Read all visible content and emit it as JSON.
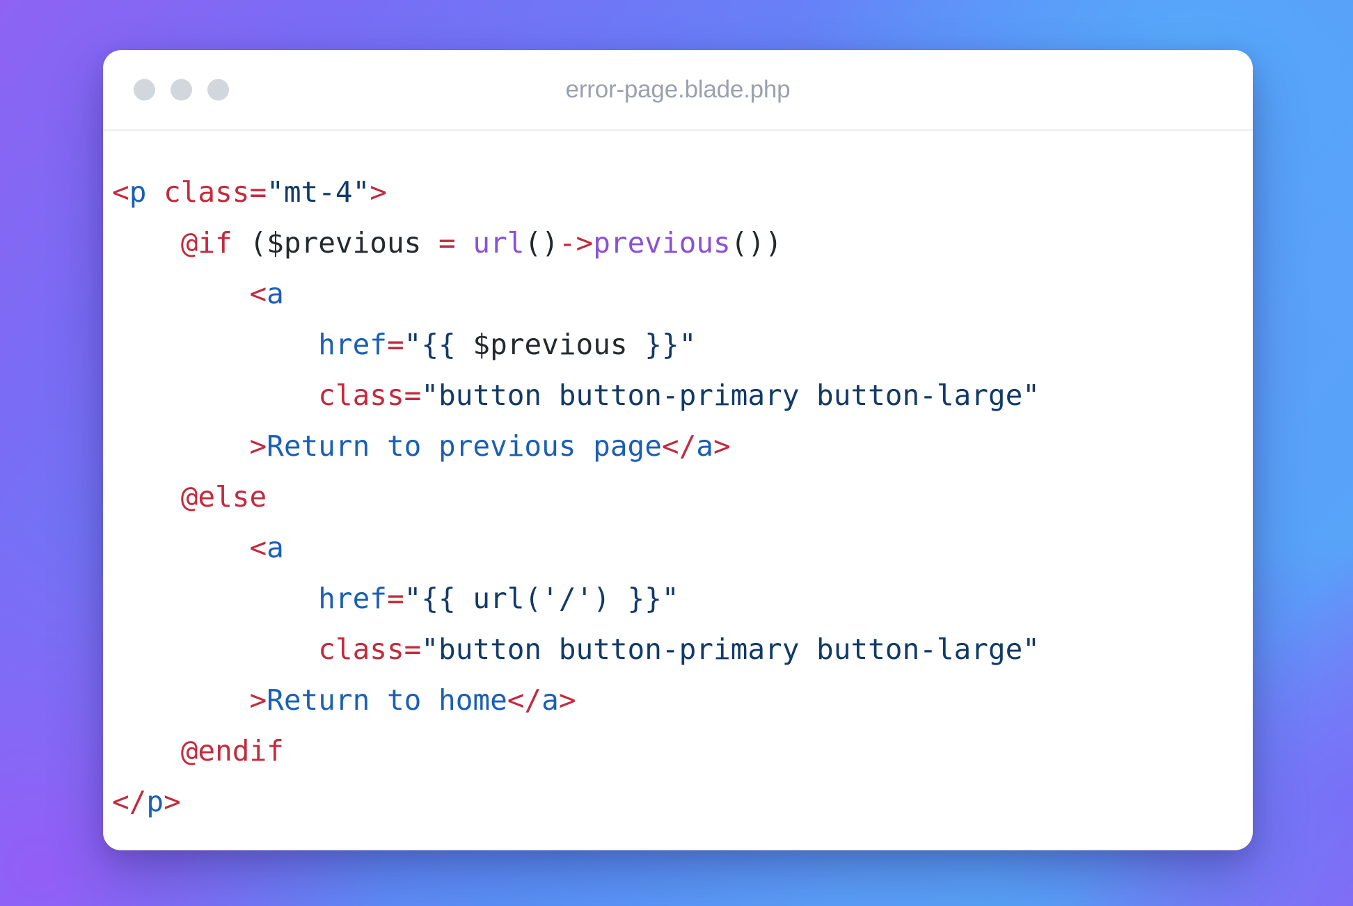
{
  "window": {
    "title": "error-page.blade.php",
    "traffic_lights": [
      {
        "name": "close",
        "color": "#d2d6dd"
      },
      {
        "name": "minimize",
        "color": "#d2d6dd"
      },
      {
        "name": "maximize",
        "color": "#d2d6dd"
      }
    ]
  },
  "theme": {
    "background_gradient_from": "#8e63f3",
    "background_gradient_to": "#57a4f9",
    "card_background": "#ffffff",
    "title_color": "#9aa1ae",
    "syntax_punctuation": "#c32b3d",
    "syntax_tag": "#1b5fb5",
    "syntax_string": "#123a68",
    "syntax_plain": "#24292e",
    "syntax_function": "#8a51d6",
    "syntax_keyword": "#c32b3d"
  },
  "code": {
    "language": "blade-php",
    "plain_text": "<p class=\"mt-4\">\n    @if ($previous = url()->previous())\n        <a\n            href=\"{{ $previous }}\"\n            class=\"button button-primary button-large\"\n        >Return to previous page</a>\n    @else\n        <a\n            href=\"{{ url('/') }}\"\n            class=\"button button-primary button-large\"\n        >Return to home</a>\n    @endif\n</p>",
    "lines": [
      {
        "n": 1,
        "indent": 0,
        "tokens": [
          {
            "t": "<",
            "c": "punct"
          },
          {
            "t": "p",
            "c": "tag"
          },
          {
            "t": " ",
            "c": "plain"
          },
          {
            "t": "class=",
            "c": "attr-red"
          },
          {
            "t": "\"mt-4\"",
            "c": "str"
          },
          {
            "t": ">",
            "c": "punct"
          }
        ]
      },
      {
        "n": 2,
        "indent": 1,
        "tokens": [
          {
            "t": "@if",
            "c": "kw"
          },
          {
            "t": " ($previous ",
            "c": "plain"
          },
          {
            "t": "=",
            "c": "punct"
          },
          {
            "t": " ",
            "c": "plain"
          },
          {
            "t": "url",
            "c": "fn"
          },
          {
            "t": "()",
            "c": "plain"
          },
          {
            "t": "->",
            "c": "punct"
          },
          {
            "t": "previous",
            "c": "fn"
          },
          {
            "t": "())",
            "c": "plain"
          }
        ]
      },
      {
        "n": 3,
        "indent": 2,
        "tokens": [
          {
            "t": "<",
            "c": "punct"
          },
          {
            "t": "a",
            "c": "tag"
          }
        ]
      },
      {
        "n": 4,
        "indent": 3,
        "tokens": [
          {
            "t": "href",
            "c": "attr-blue"
          },
          {
            "t": "=",
            "c": "punct"
          },
          {
            "t": "\"{{ ",
            "c": "str"
          },
          {
            "t": "$previous",
            "c": "plain"
          },
          {
            "t": " }}\"",
            "c": "str"
          }
        ]
      },
      {
        "n": 5,
        "indent": 3,
        "tokens": [
          {
            "t": "class=",
            "c": "attr-red"
          },
          {
            "t": "\"button button-primary button-large\"",
            "c": "str"
          }
        ]
      },
      {
        "n": 6,
        "indent": 2,
        "tokens": [
          {
            "t": ">",
            "c": "punct"
          },
          {
            "t": "Return to previous page",
            "c": "tag"
          },
          {
            "t": "</",
            "c": "punct"
          },
          {
            "t": "a",
            "c": "tag"
          },
          {
            "t": ">",
            "c": "punct"
          }
        ]
      },
      {
        "n": 7,
        "indent": 1,
        "tokens": [
          {
            "t": "@else",
            "c": "kw"
          }
        ]
      },
      {
        "n": 8,
        "indent": 2,
        "tokens": [
          {
            "t": "<",
            "c": "punct"
          },
          {
            "t": "a",
            "c": "tag"
          }
        ]
      },
      {
        "n": 9,
        "indent": 3,
        "tokens": [
          {
            "t": "href",
            "c": "attr-blue"
          },
          {
            "t": "=",
            "c": "punct"
          },
          {
            "t": "\"{{ url('/') }}\"",
            "c": "str"
          }
        ]
      },
      {
        "n": 10,
        "indent": 3,
        "tokens": [
          {
            "t": "class=",
            "c": "attr-red"
          },
          {
            "t": "\"button button-primary button-large\"",
            "c": "str"
          }
        ]
      },
      {
        "n": 11,
        "indent": 2,
        "tokens": [
          {
            "t": ">",
            "c": "punct"
          },
          {
            "t": "Return to home",
            "c": "tag"
          },
          {
            "t": "</",
            "c": "punct"
          },
          {
            "t": "a",
            "c": "tag"
          },
          {
            "t": ">",
            "c": "punct"
          }
        ]
      },
      {
        "n": 12,
        "indent": 1,
        "tokens": [
          {
            "t": "@endif",
            "c": "kw"
          }
        ]
      },
      {
        "n": 13,
        "indent": 0,
        "tokens": [
          {
            "t": "</",
            "c": "punct"
          },
          {
            "t": "p",
            "c": "tag"
          },
          {
            "t": ">",
            "c": "punct"
          }
        ]
      }
    ]
  }
}
